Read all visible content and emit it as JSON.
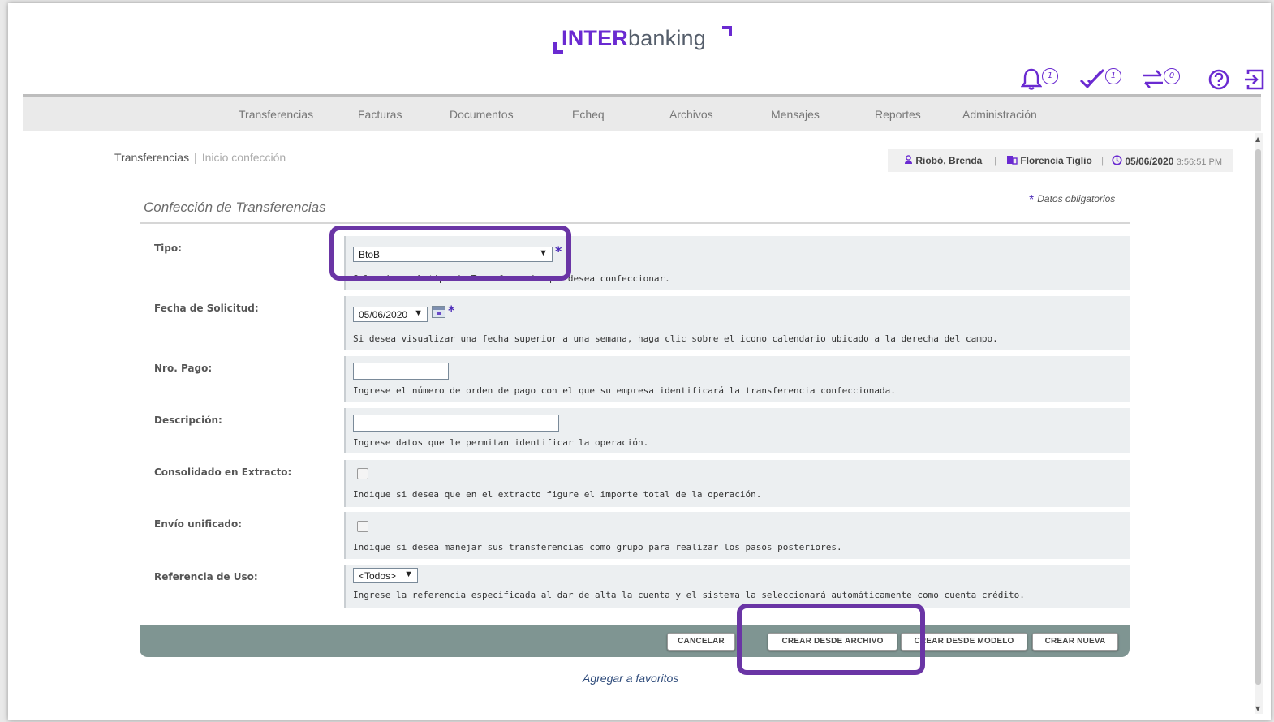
{
  "brand": {
    "inter": "INTER",
    "banking": "banking"
  },
  "header_icons": [
    {
      "name": "bell-icon",
      "count": "1"
    },
    {
      "name": "check-icon",
      "count": "1"
    },
    {
      "name": "transfer-icon",
      "count": "0"
    },
    {
      "name": "help-icon"
    },
    {
      "name": "logout-icon"
    }
  ],
  "nav": {
    "items": [
      "Transferencias",
      "Facturas",
      "Documentos",
      "Echeq",
      "Archivos",
      "Mensajes",
      "Reportes",
      "Administración"
    ]
  },
  "breadcrumb": {
    "section": "Transferencias",
    "separator": "|",
    "current": "Inicio confección"
  },
  "userbar": {
    "user": "Riobó, Brenda",
    "company": "Florencia Tiglio",
    "date": "05/06/2020",
    "time": "3:56:51 PM",
    "separator": "|"
  },
  "form": {
    "title": "Confección de Transferencias",
    "required_star": "*",
    "required_note": "Datos obligatorios",
    "tipo": {
      "label": "Tipo:",
      "value": "BtoB",
      "hint": "Seleccione el tipo de Transferencia que desea confeccionar."
    },
    "fecha": {
      "label": "Fecha de Solicitud:",
      "value": "05/06/2020",
      "hint": "Si desea visualizar una fecha superior a una semana, haga clic sobre el icono calendario ubicado a la derecha del campo."
    },
    "nro_pago": {
      "label": "Nro. Pago:",
      "value": "",
      "hint": "Ingrese el número de orden de pago con el que su empresa identificará la transferencia confeccionada."
    },
    "descripcion": {
      "label": "Descripción:",
      "value": "",
      "hint": "Ingrese datos que le permitan identificar la operación."
    },
    "consolidado": {
      "label": "Consolidado en Extracto:",
      "checked": false,
      "hint": "Indique si desea que en el extracto figure el importe total de la operación."
    },
    "envio": {
      "label": "Envío unificado:",
      "checked": false,
      "hint": "Indique si desea manejar sus transferencias como grupo para realizar los pasos posteriores."
    },
    "referencia": {
      "label": "Referencia de Uso:",
      "value": "<Todos>",
      "hint": "Ingrese la referencia especificada al dar de alta la cuenta y el sistema la seleccionará automáticamente como cuenta crédito."
    }
  },
  "buttons": {
    "cancel": "CANCELAR",
    "from_file": "CREAR DESDE ARCHIVO",
    "from_model": "CREAR DESDE MODELO",
    "new": "CREAR NUEVA"
  },
  "favorites_link": "Agregar a favoritos",
  "colors": {
    "brand_purple": "#6a2ad1",
    "highlight": "#6a35a5",
    "button_bar": "#7f9592"
  }
}
